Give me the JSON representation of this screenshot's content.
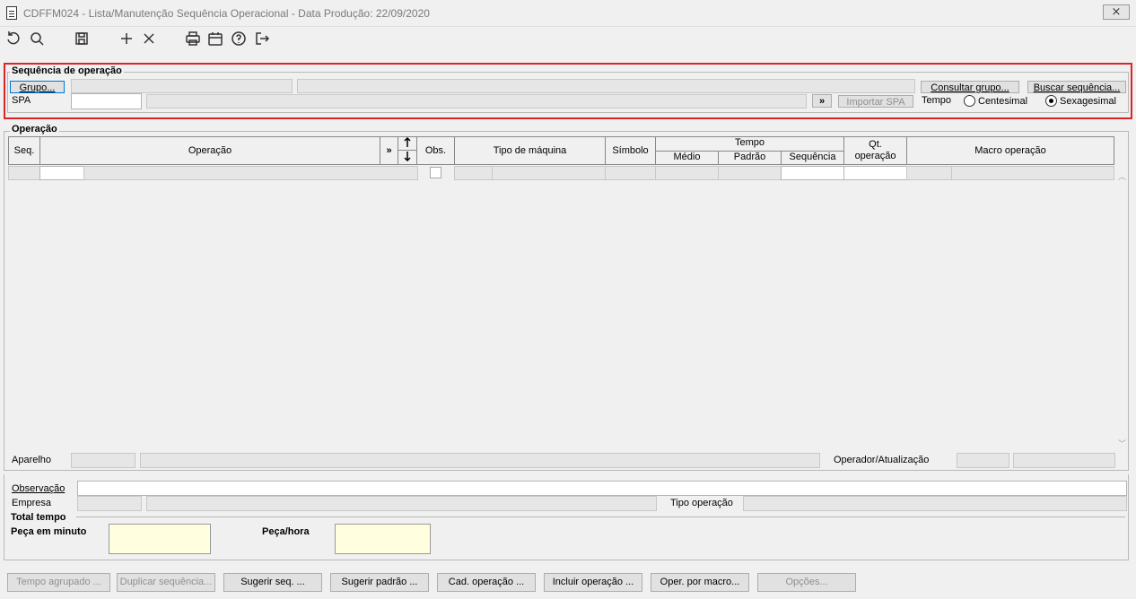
{
  "window": {
    "title": "CDFFM024 - Lista/Manutenção Sequência Operacional - Data Produção: 22/09/2020",
    "close_glyph": "⨯"
  },
  "toolbar": {
    "icons": [
      "refresh-icon",
      "search-icon",
      "save-icon",
      "add-icon",
      "delete-icon",
      "print-icon",
      "calendar-icon",
      "help-icon",
      "exit-icon"
    ]
  },
  "sequencia": {
    "legend": "Sequência de operação",
    "grupo_button": "Grupo...",
    "spa_label": "SPA",
    "spa_value": "",
    "more_button": "»",
    "importar_spa_button": "Importar SPA",
    "consultar_grupo_button": "Consultar grupo...",
    "buscar_sequencia_button": "Buscar sequência...",
    "tempo_label": "Tempo",
    "centesimal_label": "Centesimal",
    "sexagesimal_label": "Sexagesimal",
    "selected_tempo": "Sexagesimal"
  },
  "operacao": {
    "legend": "Operação",
    "columns": {
      "seq": "Seq.",
      "operacao": "Operação",
      "expand": "»",
      "obs": "Obs.",
      "tipo_maquina": "Tipo de máquina",
      "simbolo": "Símbolo",
      "tempo": "Tempo",
      "medio": "Médio",
      "padrao": "Padrão",
      "sequencia": "Sequência",
      "qt_operacao_1": "Qt.",
      "qt_operacao_2": "operação",
      "macro_operacao": "Macro operação"
    },
    "aparelho_label": "Aparelho",
    "operador_label": "Operador/Atualização"
  },
  "details": {
    "observacao_label": "Observação",
    "empresa_label": "Empresa",
    "tipo_operacao_label": "Tipo operação",
    "total_tempo_label": "Total tempo",
    "peca_minuto_label": "Peça em minuto",
    "peca_hora_label": "Peça/hora"
  },
  "footer_buttons": {
    "tempo_agrupado": "Tempo agrupado ...",
    "duplicar_sequencia": "Duplicar sequência...",
    "sugerir_seq": "Sugerir seq. ...",
    "sugerir_padrao": "Sugerir padrão ...",
    "cad_operacao": "Cad. operação ...",
    "incluir_operacao": "Incluir operação ...",
    "oper_por_macro": "Oper. por macro...",
    "opcoes": "Opções..."
  }
}
